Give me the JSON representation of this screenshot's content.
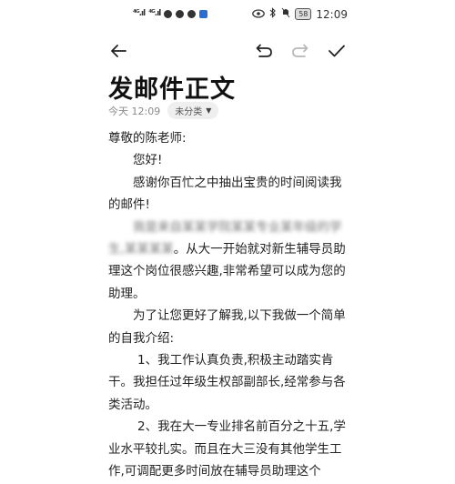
{
  "status_bar": {
    "signal_left": "⁴ᴳ.ıl",
    "signal_right": "⁴ᴳ.ıl",
    "battery": "58",
    "time": "12:09"
  },
  "toolbar": {
    "back_icon": "back-arrow-icon",
    "undo_icon": "undo-icon",
    "redo_icon": "redo-icon",
    "save_icon": "check-icon"
  },
  "title": "发邮件正文",
  "meta": {
    "time": "今天 12:09",
    "category": "未分类"
  },
  "body": {
    "greeting": "尊敬的陈老师:",
    "hello": "您好!",
    "thanks": "感谢你百忙之中抽出宝贵的时间阅读我的邮件!",
    "intro_blurred": "我是来自某某学院某某专业某年级的学生,某某",
    "intro_line2_blurred": "某某",
    "intro_rest": "。从大一开始就对新生辅导员助理这个岗位很感兴趣,非常希望可以成为您的助理。",
    "self_intro_lead": "为了让您更好了解我,以下我做一个简单的自我介绍:",
    "point1": "1、我工作认真负责,积极主动踏实肯干。我担任过年级生权部副部长,经常参与各类活动。",
    "point2": "2、我在大一专业排名前百分之十五,学业水平较扎实。而且在大三没有其他学生工作,可调配更多时间放在辅导员助理这个"
  }
}
